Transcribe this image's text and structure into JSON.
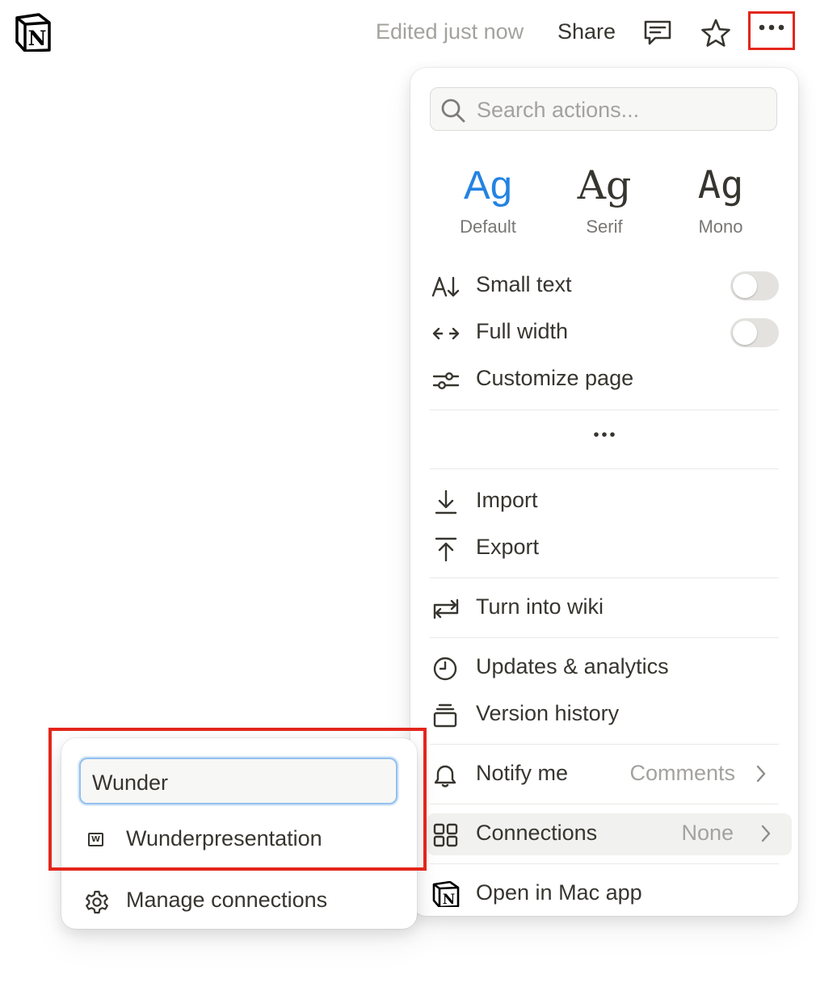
{
  "topbar": {
    "logo_letter": "N",
    "edited_status": "Edited just now",
    "share_label": "Share",
    "icons": [
      "notion-logo",
      "comment-icon",
      "star-icon",
      "more-icon"
    ]
  },
  "menu": {
    "search_placeholder": "Search actions...",
    "fonts": [
      {
        "sample": "Ag",
        "label": "Default",
        "selected": true
      },
      {
        "sample": "Ag",
        "label": "Serif"
      },
      {
        "sample": "Ag",
        "label": "Mono"
      }
    ],
    "toggles": [
      {
        "label": "Small text",
        "icon": "small-text-icon",
        "on": false
      },
      {
        "label": "Full width",
        "icon": "full-width-icon",
        "on": false
      }
    ],
    "customize_label": "Customize page",
    "import_label": "Import",
    "export_label": "Export",
    "wiki_label": "Turn into wiki",
    "analytics_label": "Updates & analytics",
    "history_label": "Version history",
    "notify": {
      "label": "Notify me",
      "value": "Comments"
    },
    "connections": {
      "label": "Connections",
      "value": "None"
    },
    "open_app_label": "Open in Mac app",
    "accent_color": "#2383e2",
    "highlight_color": "#e3261b"
  },
  "connections_popover": {
    "input_value": "Wunder",
    "results": [
      {
        "label": "Wunderpresentation",
        "badge": "W"
      }
    ],
    "manage_label": "Manage connections"
  }
}
